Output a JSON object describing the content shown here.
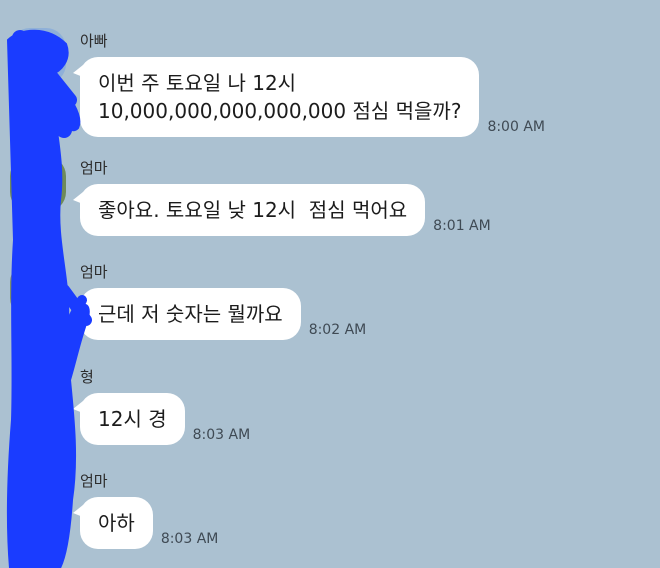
{
  "messages": [
    {
      "sender": "아빠",
      "lines": "이번 주 토요일 나 12시\n10,000,000,000,000,000 점심 먹을까?",
      "time": "8:00 AM"
    },
    {
      "sender": "엄마",
      "lines": "좋아요. 토요일 낮 12시  점심 먹어요",
      "time": "8:01 AM"
    },
    {
      "sender": "엄마",
      "lines": "근데 저 숫자는 뭘까요",
      "time": "8:02 AM"
    },
    {
      "sender": "형",
      "lines": "12시 경",
      "time": "8:03 AM"
    },
    {
      "sender": "엄마",
      "lines": "아하",
      "time": "8:03 AM"
    }
  ],
  "colors": {
    "background": "#abc1d1",
    "bubble": "#ffffff",
    "scribble": "#1a3cff"
  }
}
